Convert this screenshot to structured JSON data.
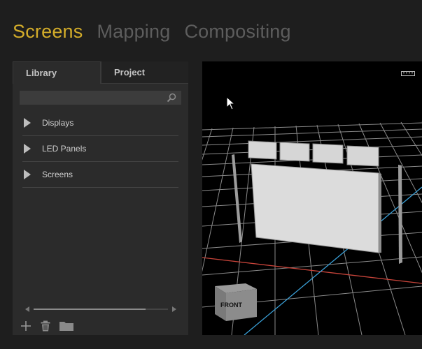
{
  "top_tabs": [
    {
      "label": "Screens",
      "active": true
    },
    {
      "label": "Mapping",
      "active": false
    },
    {
      "label": "Compositing",
      "active": false
    }
  ],
  "panel": {
    "tabs": [
      {
        "label": "Library",
        "active": true
      },
      {
        "label": "Project",
        "active": false
      }
    ],
    "search": {
      "value": "",
      "placeholder": ""
    },
    "tree_items": [
      {
        "label": "Displays",
        "expanded": false
      },
      {
        "label": "LED Panels",
        "expanded": false
      },
      {
        "label": "Screens",
        "expanded": false
      }
    ],
    "toolbar_icons": [
      "add-icon",
      "trash-icon",
      "folder-icon"
    ]
  },
  "viewport": {
    "orientation_cube_label": "FRONT",
    "icons": [
      "ruler-icon",
      "cursor-icon"
    ]
  },
  "colors": {
    "accent": "#d4ad2a",
    "inactive_tab": "#5d5d5d",
    "x_axis": "#c8443a",
    "z_axis": "#3aa0d8",
    "grid": "#8a8a8a"
  }
}
